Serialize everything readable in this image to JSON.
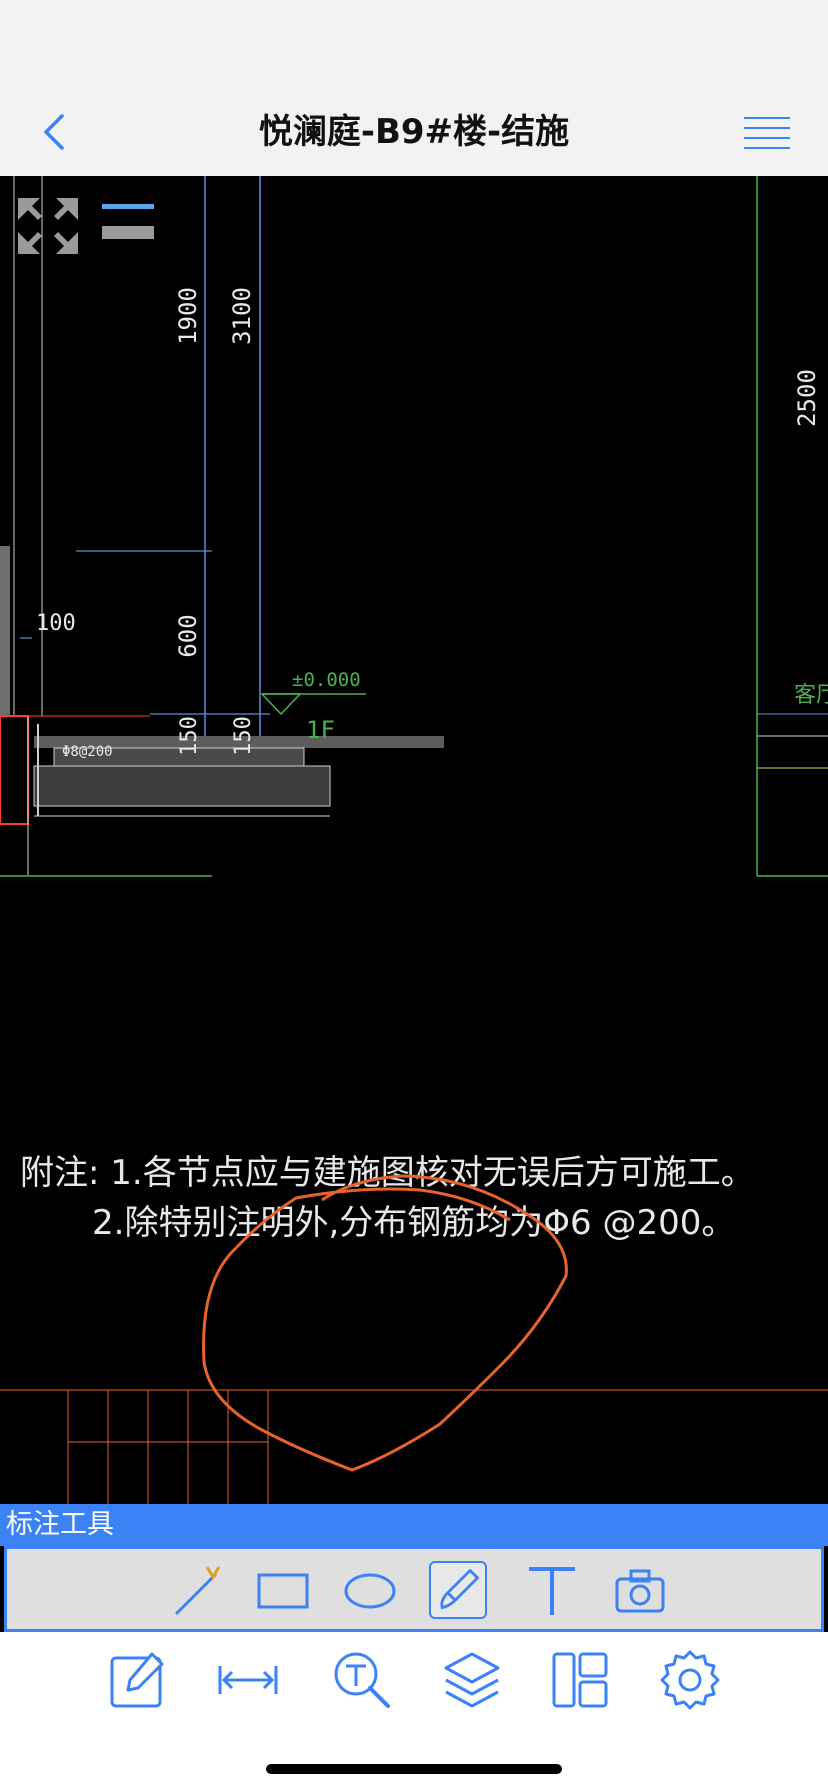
{
  "nav": {
    "title": "悦澜庭-B9#楼-结施"
  },
  "drawing": {
    "dimensions": {
      "d1900": "1900",
      "d3100": "3100",
      "d2500": "2500",
      "d100": "100",
      "d600": "600",
      "d150a": "150",
      "d150b": "150"
    },
    "level_mark": "±0.000",
    "floor_label": "1F",
    "room_label": "客厅",
    "rebar_label": "Φ8@200",
    "notes": {
      "line1": "附注: 1.各节点应与建施图核对无误后方可施工。",
      "line2": "2.除特别注明外,分布钢筋均为Φ6 @200。"
    }
  },
  "annotation_tools": {
    "header": "标注工具",
    "items": [
      {
        "name": "line-tool",
        "icon": "line-arrow-icon"
      },
      {
        "name": "rectangle-tool",
        "icon": "rectangle-icon"
      },
      {
        "name": "ellipse-tool",
        "icon": "ellipse-icon"
      },
      {
        "name": "pen-tool",
        "icon": "pen-icon",
        "active": true
      },
      {
        "name": "text-tool",
        "icon": "text-t-icon"
      },
      {
        "name": "camera-tool",
        "icon": "camera-icon"
      }
    ]
  },
  "bottom_toolbar": {
    "items": [
      {
        "name": "markup-button",
        "icon": "edit-icon"
      },
      {
        "name": "measure-button",
        "icon": "measure-icon"
      },
      {
        "name": "text-search-button",
        "icon": "text-search-icon"
      },
      {
        "name": "layers-button",
        "icon": "layers-icon"
      },
      {
        "name": "layout-button",
        "icon": "layout-icon"
      },
      {
        "name": "settings-button",
        "icon": "gear-icon"
      }
    ]
  },
  "colors": {
    "accent": "#3b82f6",
    "cad_white": "#e8e8e8",
    "cad_green": "#4caf50",
    "cad_blue": "#5b8fd6",
    "cad_red": "#ff3b30",
    "markup_orange": "#e8622b"
  }
}
